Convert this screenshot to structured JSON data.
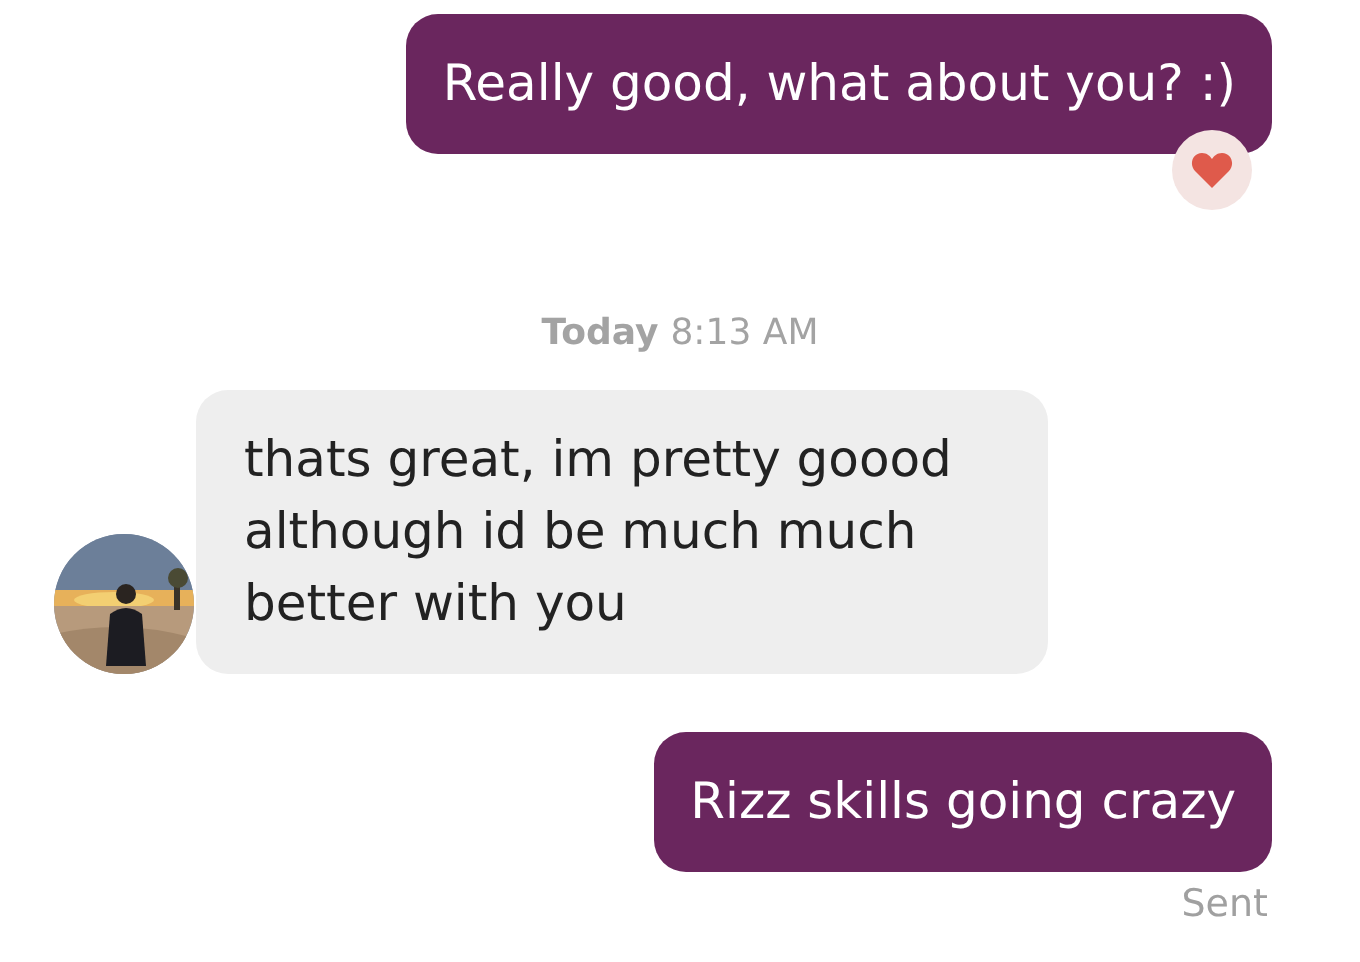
{
  "messages": [
    {
      "kind": "outgoing",
      "text": "Really good, what about you? :)",
      "liked": true
    },
    {
      "kind": "timestamp",
      "day": "Today",
      "time": "8:13 AM"
    },
    {
      "kind": "incoming",
      "text": "thats great, im pretty goood\nalthough id be much much\nbetter with you",
      "avatar": true
    },
    {
      "kind": "outgoing",
      "text": "Rizz skills going crazy",
      "status": "Sent"
    }
  ]
}
